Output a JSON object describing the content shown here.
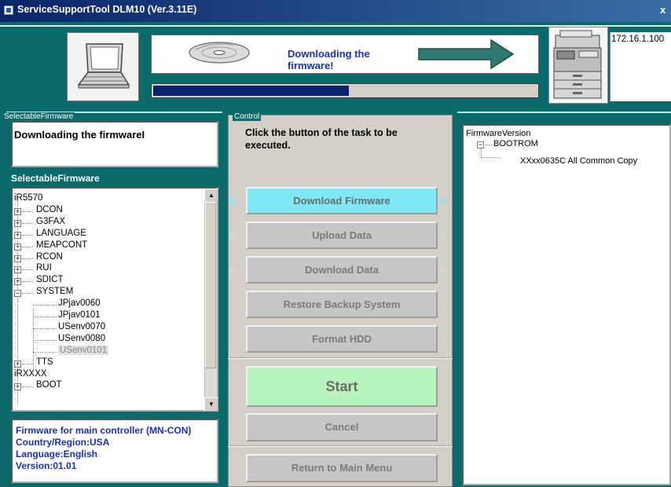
{
  "window": {
    "title": "ServiceSupportTool DLM10 (Ver.3.11E)",
    "close_glyph": "x"
  },
  "header": {
    "status_text": "Downloading the firmware!",
    "progress_value": 0.51,
    "ip_address": "172.16.1.100"
  },
  "left": {
    "group_label": "SelectableFirmware",
    "download_message": "Downloading the firmwareI",
    "list_title": "SelectableFirmware",
    "tree": [
      {
        "label": "iR5570",
        "level": 0,
        "toggle": ""
      },
      {
        "label": "DCON",
        "level": 1,
        "toggle": "+"
      },
      {
        "label": "G3FAX",
        "level": 1,
        "toggle": "+"
      },
      {
        "label": "LANGUAGE",
        "level": 1,
        "toggle": "+"
      },
      {
        "label": "MEAPCONT",
        "level": 1,
        "toggle": "+"
      },
      {
        "label": "RCON",
        "level": 1,
        "toggle": "+"
      },
      {
        "label": "RUI",
        "level": 1,
        "toggle": "+"
      },
      {
        "label": "SDICT",
        "level": 1,
        "toggle": "+"
      },
      {
        "label": "SYSTEM",
        "level": 1,
        "toggle": "-"
      },
      {
        "label": "JPjav0060",
        "level": 2,
        "toggle": ""
      },
      {
        "label": "JPjav0101",
        "level": 2,
        "toggle": ""
      },
      {
        "label": "USenv0070",
        "level": 2,
        "toggle": ""
      },
      {
        "label": "USenv0080",
        "level": 2,
        "toggle": ""
      },
      {
        "label": "USenv0101",
        "level": 2,
        "toggle": "",
        "selected": true
      },
      {
        "label": "TTS",
        "level": 1,
        "toggle": "+"
      },
      {
        "label": "iRXXXX",
        "level": 0,
        "toggle": ""
      },
      {
        "label": "BOOT",
        "level": 1,
        "toggle": "+"
      }
    ],
    "info_lines": [
      "Firmware for main controller (MN-CON)",
      "Country/Region:USA",
      "Language:English",
      "Version:01.01"
    ]
  },
  "control": {
    "group_label": "Control",
    "instruction": "Click the button of the task to be executed.",
    "buttons": {
      "download_firmware": "Download Firmware",
      "upload_data": "Upload Data",
      "download_data": "Download Data",
      "restore_backup": "Restore Backup System",
      "format_hdd": "Format HDD",
      "start": "Start",
      "cancel": "Cancel",
      "return_main": "Return to Main Menu"
    },
    "arrows": {
      "right_double": "»",
      "left_double": "«",
      "right_single": "›"
    }
  },
  "right": {
    "firmware_version_label": "FirmwareVersion",
    "bootrom_label": "BOOTROM",
    "bootrom_entry": "XXxx0635C All Common Copy"
  },
  "colors": {
    "background": "#0b6a6a",
    "title_bar": "#0a246a",
    "active_button": "#7ee8f4",
    "start_button": "#b8f4c0",
    "info_text": "#1a2fbd"
  }
}
